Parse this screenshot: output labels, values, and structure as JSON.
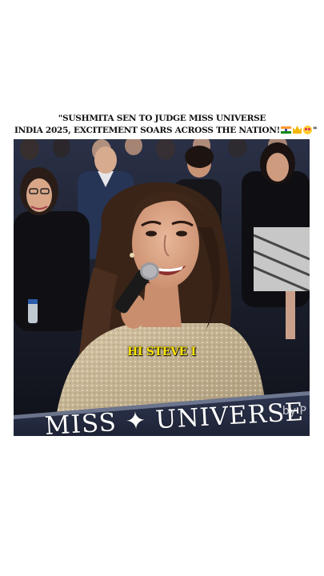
{
  "headline": {
    "line1": "\"SUSHMITA SEN TO JUDGE MISS UNIVERSE",
    "line2": "INDIA 2025, EXCITEMENT SOARS ACROSS THE NATION!",
    "line2_end": "\"",
    "emojis": [
      "india-flag-icon",
      "crown-icon",
      "heart-eyes-icon"
    ]
  },
  "video": {
    "caption": "HI STEVE I",
    "banner_text": "MISS ✦ UNIVERSE",
    "watermark": "by P"
  },
  "colors": {
    "caption": "#ffe500",
    "background": "#ffffff",
    "dress": "#cdbb9c",
    "hair": "#3a2418"
  }
}
